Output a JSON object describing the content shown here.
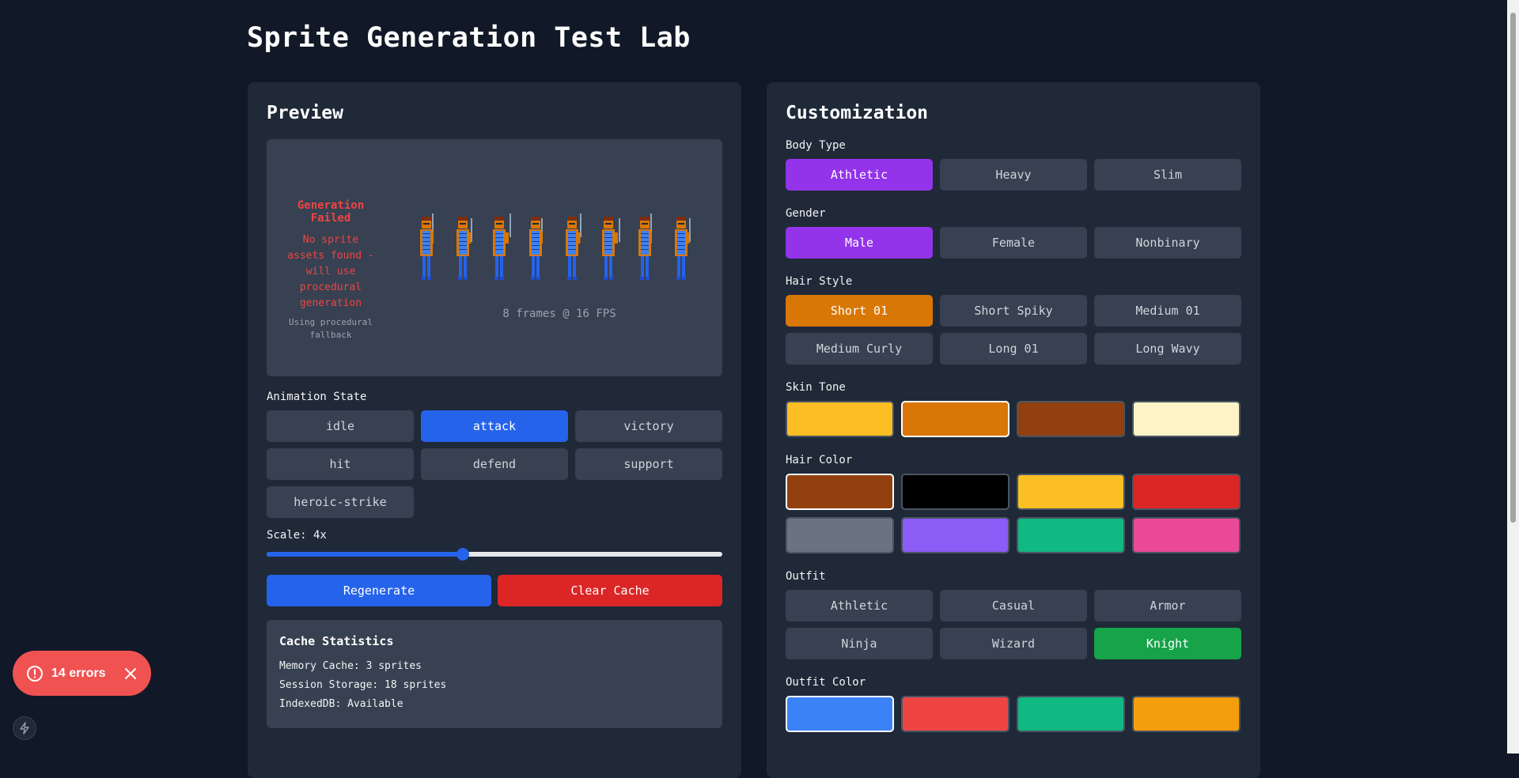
{
  "page": {
    "title": "Sprite Generation Test Lab"
  },
  "preview": {
    "heading": "Preview",
    "error_title": "Generation Failed",
    "error_message": "No sprite assets found - will use procedural generation",
    "fallback_note": "Using procedural fallback",
    "frames_label": "8 frames @ 16 FPS",
    "animation_label": "Animation State",
    "animation_states": [
      "idle",
      "attack",
      "victory",
      "hit",
      "defend",
      "support",
      "heroic-strike"
    ],
    "animation_selected": "attack",
    "scale_label": "Scale: 4x",
    "scale_fraction": 0.43,
    "regenerate_label": "Regenerate",
    "clear_cache_label": "Clear Cache",
    "cache": {
      "title": "Cache Statistics",
      "memory": "Memory Cache: 3 sprites",
      "session": "Session Storage: 18 sprites",
      "indexeddb": "IndexedDB: Available"
    }
  },
  "customization": {
    "heading": "Customization",
    "body_type": {
      "label": "Body Type",
      "options": [
        "Athletic",
        "Heavy",
        "Slim"
      ],
      "selected": "Athletic"
    },
    "gender": {
      "label": "Gender",
      "options": [
        "Male",
        "Female",
        "Nonbinary"
      ],
      "selected": "Male"
    },
    "hair_style": {
      "label": "Hair Style",
      "options": [
        "Short 01",
        "Short Spiky",
        "Medium 01",
        "Medium Curly",
        "Long 01",
        "Long Wavy"
      ],
      "selected": "Short 01"
    },
    "skin_tone": {
      "label": "Skin Tone",
      "colors": [
        "#fbbf24",
        "#d97706",
        "#92400e",
        "#fef3c7"
      ],
      "selected_index": 1
    },
    "hair_color": {
      "label": "Hair Color",
      "colors": [
        "#92400e",
        "#000000",
        "#fbbf24",
        "#dc2626",
        "#6b7280",
        "#8b5cf6",
        "#10b981",
        "#ec4899"
      ],
      "selected_index": 0
    },
    "outfit": {
      "label": "Outfit",
      "options": [
        "Athletic",
        "Casual",
        "Armor",
        "Ninja",
        "Wizard",
        "Knight"
      ],
      "selected": "Knight"
    },
    "outfit_color": {
      "label": "Outfit Color",
      "colors": [
        "#3b82f6",
        "#ef4444",
        "#10b981",
        "#f59e0b"
      ],
      "selected_index": 0
    }
  },
  "error_toast": {
    "label": "14 errors",
    "icon": "alert-circle-icon",
    "close_icon": "close-icon"
  },
  "bolt_icon": "lightning-bolt-icon"
}
